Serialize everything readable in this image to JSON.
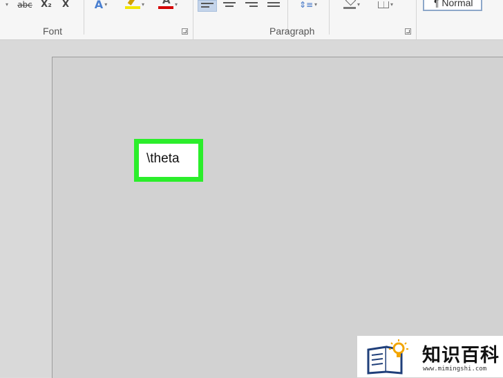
{
  "ribbon": {
    "font_group_label": "Font",
    "paragraph_group_label": "Paragraph",
    "style_normal_label": "¶ Normal",
    "tools": {
      "strikethrough_label": "abc",
      "subscript_label": "X₂",
      "clear_format_label": "X",
      "text_effects_label": "A",
      "font_color_label": "A"
    },
    "colors": {
      "highlight_yellow": "#f2e600",
      "font_color_red": "#d40000",
      "text_effects_blue": "#4a7fd0"
    }
  },
  "document": {
    "typed_text": "\\theta",
    "highlight_color": "#2bee2b"
  },
  "watermark": {
    "brand_text": "知识百科",
    "url": "www.mimingshi.com"
  }
}
